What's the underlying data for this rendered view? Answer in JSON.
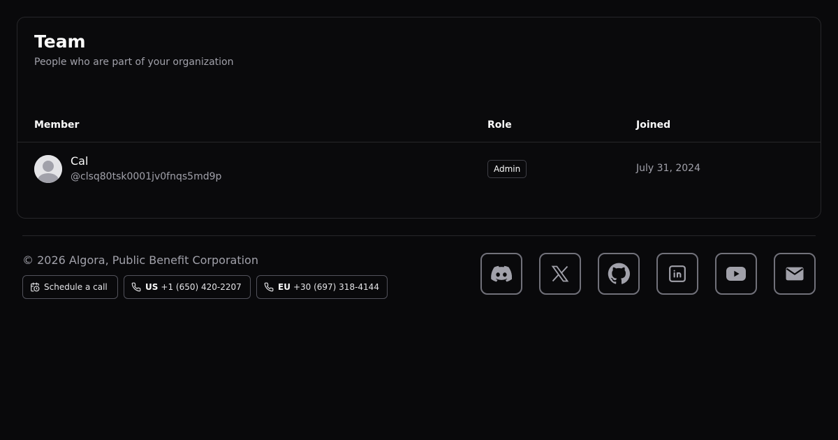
{
  "team": {
    "title": "Team",
    "subtitle": "People who are part of your organization",
    "columns": {
      "member": "Member",
      "role": "Role",
      "joined": "Joined"
    },
    "members": [
      {
        "name": "Cal",
        "handle": "@clsq80tsk0001jv0fnqs5md9p",
        "role": "Admin",
        "joined": "July 31, 2024"
      }
    ]
  },
  "footer": {
    "copyright": "© 2026 Algora, Public Benefit Corporation",
    "schedule_label": "Schedule a call",
    "us_region": "US",
    "us_phone": "+1 (650) 420-2207",
    "eu_region": "EU",
    "eu_phone": "+30 (697) 318-4144",
    "social": [
      "discord-icon",
      "x-icon",
      "github-icon",
      "linkedin-icon",
      "youtube-icon",
      "mail-icon"
    ]
  },
  "colors": {
    "background": "#09090b",
    "border": "#27272a",
    "muted_text": "#a1a1aa",
    "icon": "#a1a1aa"
  }
}
